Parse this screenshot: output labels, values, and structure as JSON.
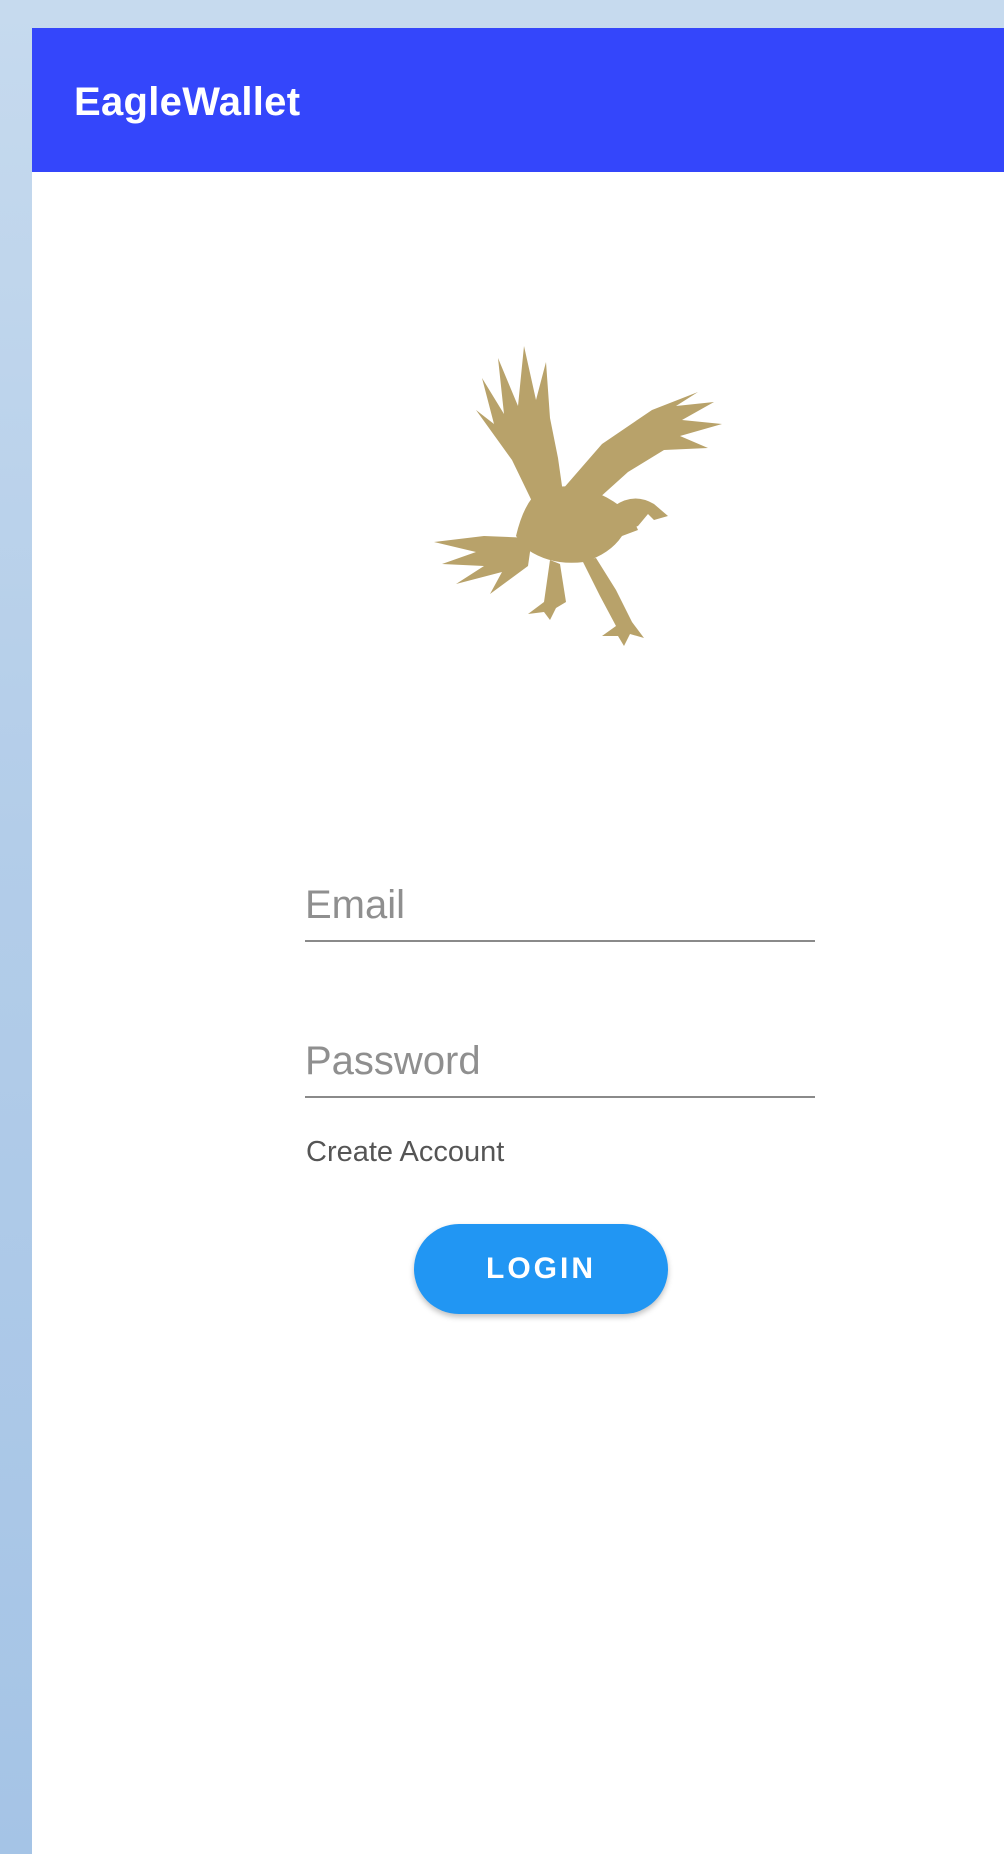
{
  "app_bar": {
    "title": "EagleWallet",
    "color": "#3446fb"
  },
  "logo": {
    "icon": "eagle-logo",
    "color": "#b8a26a"
  },
  "form": {
    "email_placeholder": "Email",
    "email_value": "",
    "password_placeholder": "Password",
    "password_value": "",
    "create_account_label": "Create Account",
    "login_label": "LOGIN",
    "login_color": "#2196f3"
  }
}
